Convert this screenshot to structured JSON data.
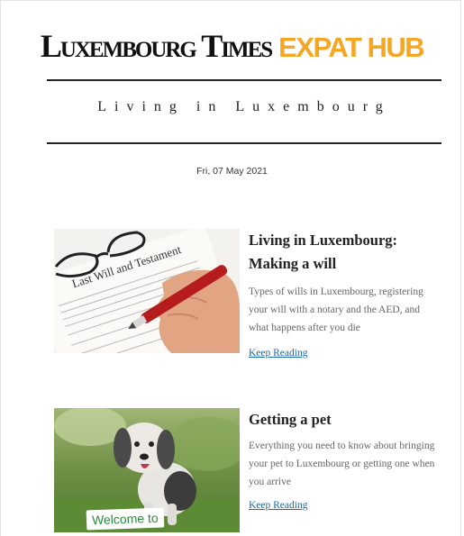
{
  "masthead": {
    "name": "Luxembourg Times",
    "accent": "EXPAT HUB"
  },
  "section": {
    "title": "Living in Luxembourg"
  },
  "date": "Fri, 07 May 2021",
  "articles": [
    {
      "headline_line1": "Living in Luxembourg:",
      "headline_line2": "Making a will",
      "description": "Types of wills in Luxembourg, registering your will with a notary and the AED, and what happens after you die",
      "link": "Keep Reading",
      "image_texts": {
        "title": "Last Will and Testament"
      }
    },
    {
      "headline_line1": "Getting a pet",
      "description": "Everything you need to know about bringing your pet to Luxembourg or getting one when you arrive",
      "link": "Keep Reading",
      "image_texts": {
        "sign": "Welcome to"
      }
    }
  ],
  "colors": {
    "accent": "#f5a623",
    "link": "#1a6aa8",
    "text": "#222222",
    "muted": "#666666"
  }
}
